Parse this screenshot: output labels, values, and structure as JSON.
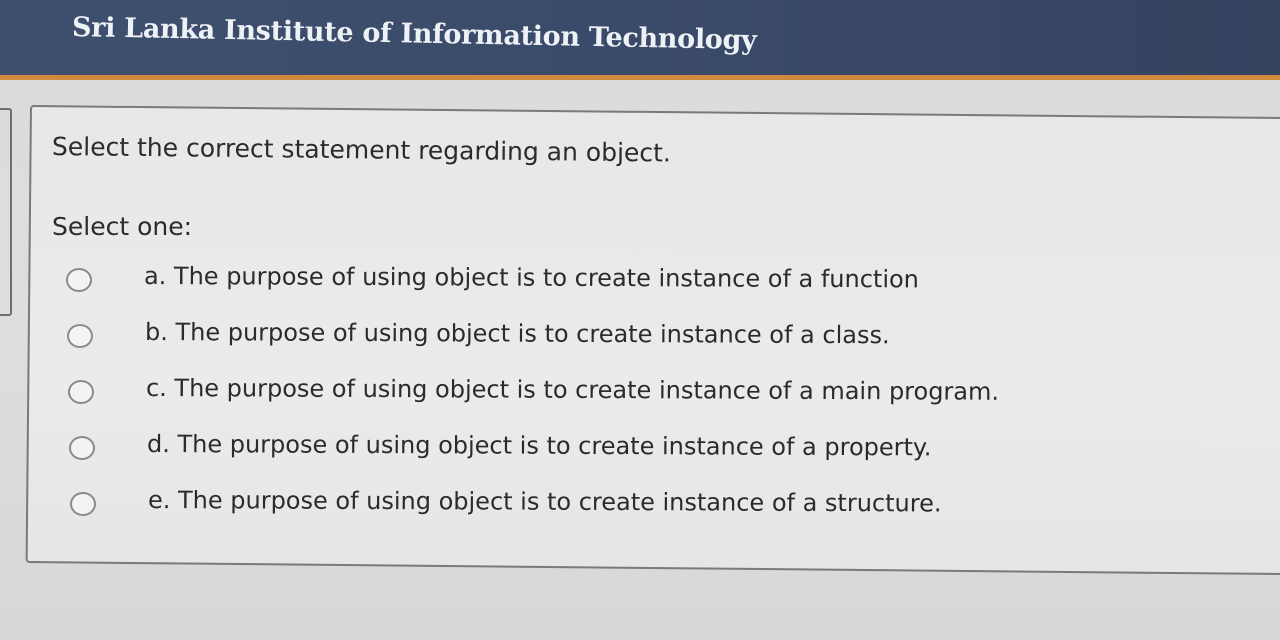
{
  "header": {
    "title": "Sri Lanka Institute of Information Technology"
  },
  "question": {
    "text": "Select the correct statement regarding an object.",
    "prompt": "Select one:",
    "options": [
      {
        "label": "a. The purpose of using object is to create instance of a function",
        "selected": false
      },
      {
        "label": "b. The purpose of using object is to create instance of a class.",
        "selected": false
      },
      {
        "label": "c. The purpose of using object is to create instance of a main program.",
        "selected": false
      },
      {
        "label": "d. The purpose of using object is to create instance of a property.",
        "selected": false
      },
      {
        "label": "e. The purpose of using object is to create instance of a structure.",
        "selected": false
      }
    ]
  },
  "colors": {
    "header_bg": "#3a4a69",
    "header_accent": "#d08a3c",
    "page_bg": "#dcdedf",
    "text": "#2b2b2b"
  }
}
